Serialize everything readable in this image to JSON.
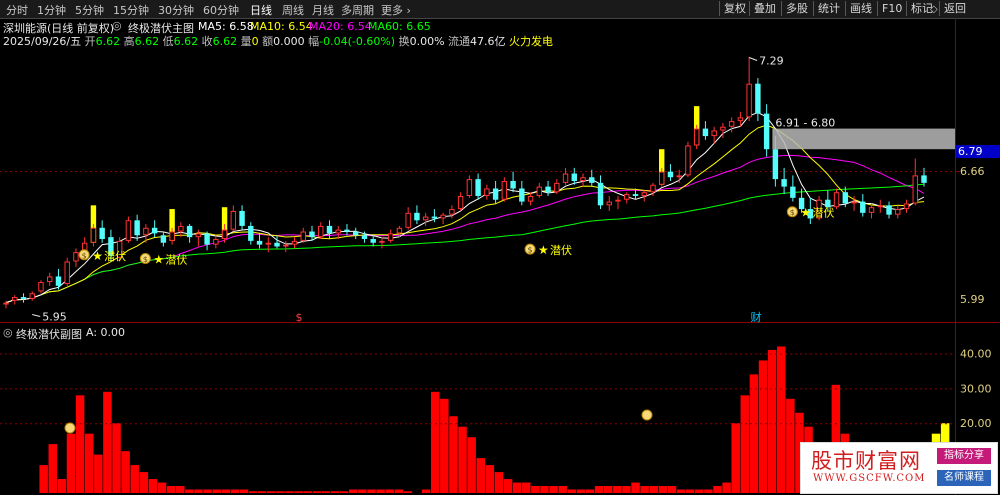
{
  "toolbar": {
    "periods": [
      "分时",
      "1分钟",
      "5分钟",
      "15分钟",
      "30分钟",
      "60分钟",
      "日线",
      "周线",
      "月线",
      "多周期",
      "更多"
    ],
    "active_period": "日线",
    "right_buttons": [
      "复权",
      "叠加",
      "多股",
      "统计",
      "画线",
      "F10",
      "标记",
      "返回"
    ]
  },
  "main_header": {
    "stock": "深圳能源(日线 前复权)",
    "indicator": "终极潜伏主图",
    "ma5_label": "MA5:",
    "ma5_value": "6.58",
    "ma10_label": "MA10:",
    "ma10_value": "6.54",
    "ma20_label": "MA20:",
    "ma20_value": "6.54",
    "ma60_label": "MA60:",
    "ma60_value": "6.65"
  },
  "quote_line": {
    "date": "2025/09/26/五",
    "open_label": "开",
    "open": "6.62",
    "high_label": "高",
    "high": "6.62",
    "low_label": "低",
    "low": "6.62",
    "close_label": "收",
    "close": "6.62",
    "volume_label": "量",
    "volume": "0",
    "amount_label": "额",
    "amount": "0.000",
    "change_label": "幅",
    "change": "-0.04(-0.60%)",
    "turnover_label": "换",
    "turnover": "0.00%",
    "float_label": "流通",
    "float": "47.6亿",
    "sector": "火力发电"
  },
  "price_axis": {
    "top_label": "6.79",
    "mid_label": "6.66",
    "bottom_label": "5.99"
  },
  "annotations": {
    "high_price": "7.29",
    "low_price": "5.95",
    "range_label": "6.91 - 6.80",
    "signal_text": "潜伏",
    "event_marker_1": "$",
    "event_marker_2": "财"
  },
  "sub_header": {
    "indicator": "终极潜伏副图",
    "a_label": "A:",
    "a_value": "0.00"
  },
  "sub_axis": [
    "40.00",
    "30.00",
    "20.00"
  ],
  "watermark": {
    "title": "股市财富网",
    "url": "WWW.GSCFW.COM",
    "tag1": "指标分享",
    "tag2": "名师课程"
  },
  "colors": {
    "up": "#ff3232",
    "down": "#54fcfc",
    "ma5": "#ffffff",
    "ma10": "#ffff00",
    "ma20": "#ff00ff",
    "ma60": "#00ff00",
    "signal_bar": "#ffff00",
    "sub_bar": "#ff0000"
  },
  "chart_data": [
    {
      "type": "candlestick",
      "ylim": [
        5.93,
        7.33
      ],
      "candles": [
        [
          5.97,
          5.99,
          5.95,
          5.98
        ],
        [
          5.99,
          6.02,
          5.97,
          6.01
        ],
        [
          6.01,
          6.03,
          5.98,
          6.0
        ],
        [
          6.0,
          6.04,
          5.99,
          6.03
        ],
        [
          6.04,
          6.1,
          6.03,
          6.09
        ],
        [
          6.09,
          6.14,
          6.07,
          6.12
        ],
        [
          6.12,
          6.16,
          6.05,
          6.07
        ],
        [
          6.08,
          6.22,
          6.07,
          6.2
        ],
        [
          6.2,
          6.27,
          6.17,
          6.25
        ],
        [
          6.25,
          6.33,
          6.23,
          6.3
        ],
        [
          6.3,
          6.4,
          6.28,
          6.38
        ],
        [
          6.38,
          6.42,
          6.3,
          6.32
        ],
        [
          6.33,
          6.37,
          6.2,
          6.23
        ],
        [
          6.22,
          6.33,
          6.2,
          6.31
        ],
        [
          6.31,
          6.44,
          6.3,
          6.42
        ],
        [
          6.42,
          6.45,
          6.31,
          6.34
        ],
        [
          6.34,
          6.4,
          6.3,
          6.38
        ],
        [
          6.38,
          6.42,
          6.33,
          6.35
        ],
        [
          6.34,
          6.36,
          6.28,
          6.3
        ],
        [
          6.31,
          6.38,
          6.29,
          6.36
        ],
        [
          6.36,
          6.41,
          6.33,
          6.39
        ],
        [
          6.39,
          6.4,
          6.3,
          6.33
        ],
        [
          6.33,
          6.37,
          6.28,
          6.35
        ],
        [
          6.35,
          6.36,
          6.26,
          6.29
        ],
        [
          6.29,
          6.34,
          6.27,
          6.32
        ],
        [
          6.32,
          6.4,
          6.3,
          6.37
        ],
        [
          6.37,
          6.5,
          6.36,
          6.47
        ],
        [
          6.47,
          6.5,
          6.37,
          6.39
        ],
        [
          6.39,
          6.41,
          6.29,
          6.31
        ],
        [
          6.31,
          6.35,
          6.27,
          6.29
        ],
        [
          6.29,
          6.33,
          6.25,
          6.3
        ],
        [
          6.3,
          6.34,
          6.27,
          6.28
        ],
        [
          6.28,
          6.31,
          6.25,
          6.29
        ],
        [
          6.29,
          6.33,
          6.27,
          6.31
        ],
        [
          6.31,
          6.38,
          6.3,
          6.36
        ],
        [
          6.36,
          6.39,
          6.31,
          6.33
        ],
        [
          6.33,
          6.41,
          6.32,
          6.39
        ],
        [
          6.39,
          6.42,
          6.32,
          6.35
        ],
        [
          6.35,
          6.39,
          6.32,
          6.37
        ],
        [
          6.37,
          6.4,
          6.34,
          6.36
        ],
        [
          6.36,
          6.38,
          6.32,
          6.34
        ],
        [
          6.34,
          6.36,
          6.3,
          6.32
        ],
        [
          6.32,
          6.34,
          6.28,
          6.3
        ],
        [
          6.3,
          6.33,
          6.27,
          6.31
        ],
        [
          6.31,
          6.37,
          6.3,
          6.35
        ],
        [
          6.35,
          6.39,
          6.33,
          6.38
        ],
        [
          6.38,
          6.49,
          6.37,
          6.46
        ],
        [
          6.46,
          6.5,
          6.4,
          6.42
        ],
        [
          6.42,
          6.46,
          6.39,
          6.44
        ],
        [
          6.44,
          6.48,
          6.41,
          6.43
        ],
        [
          6.43,
          6.46,
          6.4,
          6.45
        ],
        [
          6.45,
          6.5,
          6.43,
          6.48
        ],
        [
          6.48,
          6.57,
          6.47,
          6.55
        ],
        [
          6.55,
          6.66,
          6.54,
          6.64
        ],
        [
          6.64,
          6.67,
          6.53,
          6.55
        ],
        [
          6.55,
          6.61,
          6.53,
          6.59
        ],
        [
          6.59,
          6.63,
          6.51,
          6.53
        ],
        [
          6.53,
          6.65,
          6.52,
          6.63
        ],
        [
          6.63,
          6.68,
          6.57,
          6.59
        ],
        [
          6.59,
          6.63,
          6.5,
          6.52
        ],
        [
          6.52,
          6.57,
          6.5,
          6.55
        ],
        [
          6.55,
          6.62,
          6.54,
          6.6
        ],
        [
          6.6,
          6.63,
          6.55,
          6.57
        ],
        [
          6.57,
          6.64,
          6.56,
          6.62
        ],
        [
          6.62,
          6.7,
          6.61,
          6.67
        ],
        [
          6.67,
          6.7,
          6.61,
          6.63
        ],
        [
          6.63,
          6.67,
          6.6,
          6.65
        ],
        [
          6.65,
          6.69,
          6.6,
          6.62
        ],
        [
          6.62,
          6.66,
          6.48,
          6.5
        ],
        [
          6.5,
          6.55,
          6.47,
          6.52
        ],
        [
          6.52,
          6.55,
          6.48,
          6.53
        ],
        [
          6.53,
          6.57,
          6.51,
          6.56
        ],
        [
          6.56,
          6.59,
          6.53,
          6.55
        ],
        [
          6.55,
          6.58,
          6.52,
          6.57
        ],
        [
          6.57,
          6.62,
          6.55,
          6.61
        ],
        [
          6.61,
          6.7,
          6.6,
          6.68
        ],
        [
          6.68,
          6.72,
          6.63,
          6.65
        ],
        [
          6.65,
          6.69,
          6.62,
          6.66
        ],
        [
          6.66,
          6.84,
          6.65,
          6.82
        ],
        [
          6.82,
          6.93,
          6.8,
          6.91
        ],
        [
          6.91,
          6.95,
          6.85,
          6.87
        ],
        [
          6.87,
          6.92,
          6.83,
          6.9
        ],
        [
          6.9,
          6.94,
          6.86,
          6.92
        ],
        [
          6.92,
          6.97,
          6.89,
          6.95
        ],
        [
          6.95,
          7.0,
          6.92,
          6.97
        ],
        [
          6.97,
          7.29,
          6.95,
          7.15
        ],
        [
          7.15,
          7.18,
          6.95,
          6.99
        ],
        [
          6.99,
          7.04,
          6.76,
          6.8
        ],
        [
          6.8,
          6.87,
          6.6,
          6.64
        ],
        [
          6.64,
          6.7,
          6.56,
          6.6
        ],
        [
          6.6,
          6.66,
          6.52,
          6.54
        ],
        [
          6.54,
          6.59,
          6.46,
          6.48
        ],
        [
          6.48,
          6.54,
          6.4,
          6.43
        ],
        [
          6.43,
          6.55,
          6.42,
          6.53
        ],
        [
          6.53,
          6.58,
          6.47,
          6.49
        ],
        [
          6.49,
          6.59,
          6.48,
          6.57
        ],
        [
          6.57,
          6.6,
          6.49,
          6.51
        ],
        [
          6.51,
          6.55,
          6.47,
          6.52
        ],
        [
          6.52,
          6.56,
          6.44,
          6.46
        ],
        [
          6.46,
          6.51,
          6.43,
          6.49
        ],
        [
          6.49,
          6.53,
          6.46,
          6.5
        ],
        [
          6.5,
          6.52,
          6.43,
          6.45
        ],
        [
          6.45,
          6.5,
          6.43,
          6.48
        ],
        [
          6.48,
          6.53,
          6.46,
          6.51
        ],
        [
          6.51,
          6.75,
          6.5,
          6.66
        ],
        [
          6.66,
          6.7,
          6.6,
          6.62
        ]
      ],
      "signals": [
        8,
        16,
        47,
        72,
        81
      ],
      "signal_bars": [
        10,
        19,
        25,
        75,
        79
      ],
      "sig_ann": [
        {
          "idx": 11,
          "low": 6.3
        },
        {
          "idx": 18,
          "low": 6.28
        },
        {
          "idx": 62,
          "low": 6.33
        },
        {
          "idx": 92,
          "low": 6.53
        }
      ]
    },
    {
      "type": "bar",
      "ylim": [
        0,
        45
      ],
      "values": [
        0,
        0,
        0,
        0,
        8,
        14,
        4,
        17,
        28,
        17,
        11,
        29,
        20,
        12,
        8,
        6,
        4,
        3,
        2,
        2,
        1,
        1,
        1,
        1,
        1,
        1,
        1,
        0.5,
        0.5,
        0.5,
        0.5,
        0.5,
        0.5,
        0.5,
        0.5,
        0.5,
        0.5,
        0.5,
        1,
        1,
        1,
        1,
        1,
        1,
        0.5,
        0,
        1,
        29,
        27,
        22,
        19,
        16,
        10,
        8,
        6,
        4,
        3,
        3,
        2,
        2,
        2,
        2,
        1,
        1,
        1,
        2,
        2,
        2,
        2,
        3,
        2,
        2,
        2,
        2,
        1,
        1,
        1,
        1,
        2,
        3,
        20,
        28,
        34,
        38,
        41,
        42,
        27,
        23,
        19,
        14,
        9,
        31,
        17,
        11,
        9,
        5,
        3,
        4,
        5,
        7,
        10,
        14,
        17,
        20
      ]
    }
  ]
}
